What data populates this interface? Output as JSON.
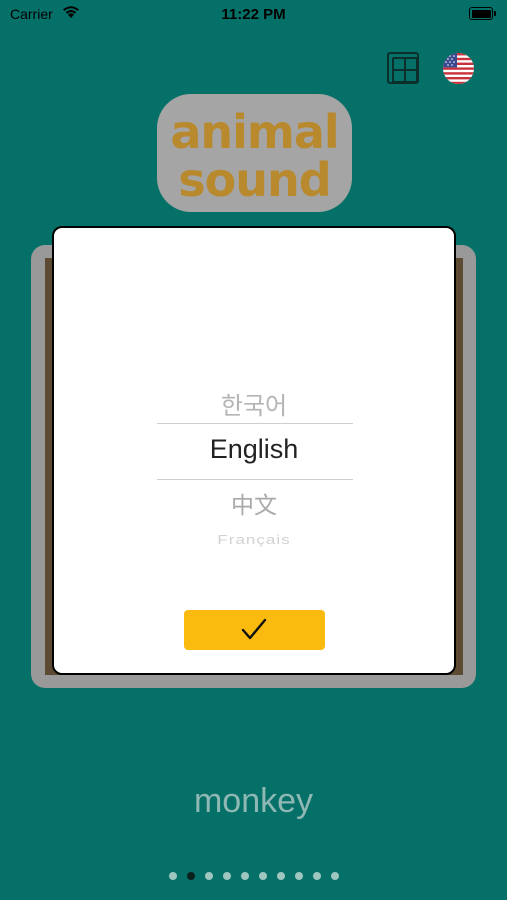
{
  "status_bar": {
    "carrier": "Carrier",
    "time": "11:22 PM"
  },
  "header": {
    "grid_icon": "grid-icon",
    "flag_icon": "us-flag-icon"
  },
  "logo": {
    "line1": "animal",
    "line2": "sound"
  },
  "language_picker": {
    "options": [
      "한국어",
      "English",
      "中文",
      "Français"
    ],
    "selected": "English",
    "confirm_icon": "checkmark-icon",
    "confirm_color": "#fbbb0e"
  },
  "animal": {
    "name": "monkey"
  },
  "pagination": {
    "total": 10,
    "current": 2
  },
  "colors": {
    "background": "#047068",
    "logo_text": "#b9892d",
    "button": "#fbbb0e"
  }
}
